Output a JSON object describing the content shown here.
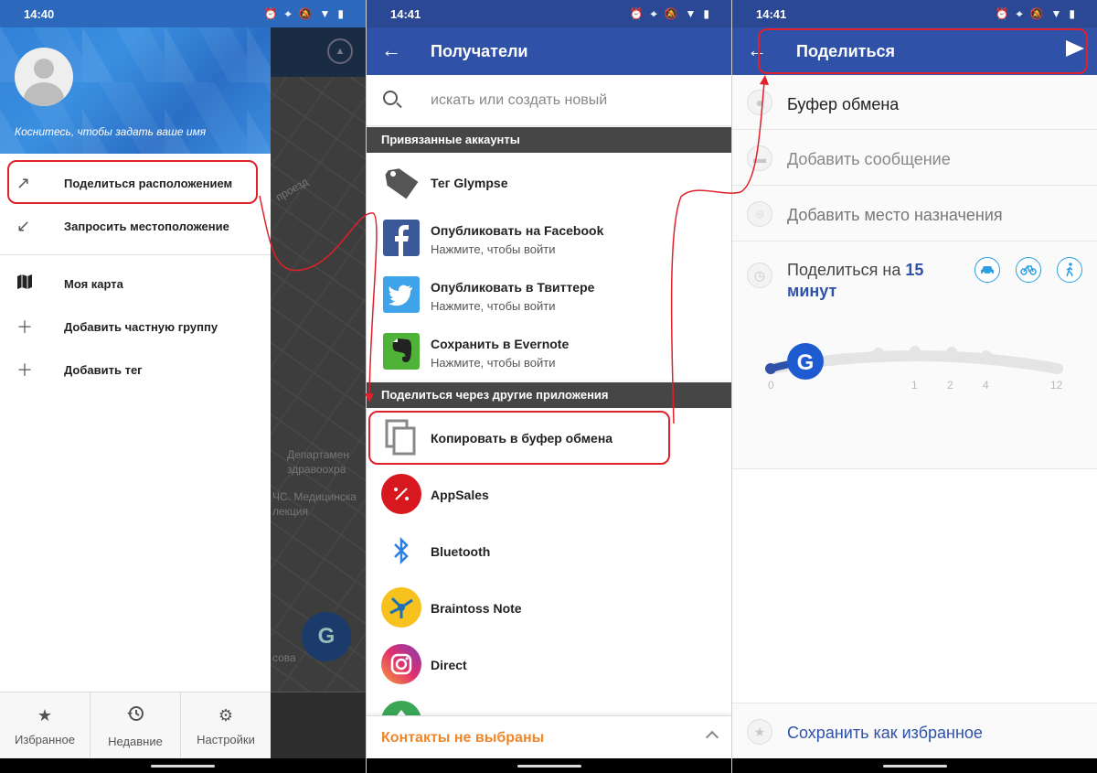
{
  "status_bar": {
    "panel1_time": "14:40",
    "panel2_time": "14:41",
    "panel3_time": "14:41"
  },
  "drawer": {
    "name_hint": "Коснитесь, чтобы задать ваше имя",
    "items": [
      {
        "label": "Поделиться расположением",
        "icon": "arrow-up-right-icon"
      },
      {
        "label": "Запросить местоположение",
        "icon": "arrow-down-left-icon"
      },
      {
        "label": "Моя карта",
        "icon": "map-icon"
      },
      {
        "label": "Добавить частную группу",
        "icon": "plus-icon"
      },
      {
        "label": "Добавить тег",
        "icon": "plus-icon"
      }
    ],
    "bottom_tabs": [
      {
        "label": "Избранное",
        "icon": "star-icon"
      },
      {
        "label": "Недавние",
        "icon": "history-icon"
      },
      {
        "label": "Настройки",
        "icon": "gear-icon"
      }
    ]
  },
  "map_background": {
    "labels": [
      "проезд",
      "Департамен",
      "здравоохра",
      "ЧС. Медицинска",
      "лекция",
      "сова"
    ]
  },
  "recipients": {
    "title": "Получатели",
    "search_placeholder": "искать или создать новый",
    "linked_header": "Привязанные аккаунты",
    "linked": [
      {
        "title": "Тег Glympse",
        "subtitle": ""
      },
      {
        "title": "Опубликовать на Facebook",
        "subtitle": "Нажмите, чтобы войти"
      },
      {
        "title": "Опубликовать в Твиттере",
        "subtitle": "Нажмите, чтобы войти"
      },
      {
        "title": "Сохранить в Evernote",
        "subtitle": "Нажмите, чтобы войти"
      }
    ],
    "other_header": "Поделиться через другие приложения",
    "other": [
      {
        "title": "Копировать в буфер обмена"
      },
      {
        "title": "AppSales"
      },
      {
        "title": "Bluetooth"
      },
      {
        "title": "Braintoss Note"
      },
      {
        "title": "Direct"
      }
    ],
    "contacts_status": "Контакты не выбраны"
  },
  "share": {
    "title": "Поделиться",
    "recipient": "Буфер обмена",
    "add_message": "Добавить сообщение",
    "add_destination": "Добавить место назначения",
    "duration_prefix": "Поделиться на",
    "duration_value": "15",
    "duration_unit": "минут",
    "slider_ticks": [
      "0",
      "1",
      "2",
      "4",
      "12"
    ],
    "save_favorite": "Сохранить как избранное"
  },
  "colors": {
    "app_bar": "#2f51a7",
    "section_header": "#464646",
    "accent_orange": "#f0862a",
    "accent_blue": "#2f51a7",
    "mode_icon": "#2c9fe0",
    "annotation_red": "#e0202a"
  }
}
